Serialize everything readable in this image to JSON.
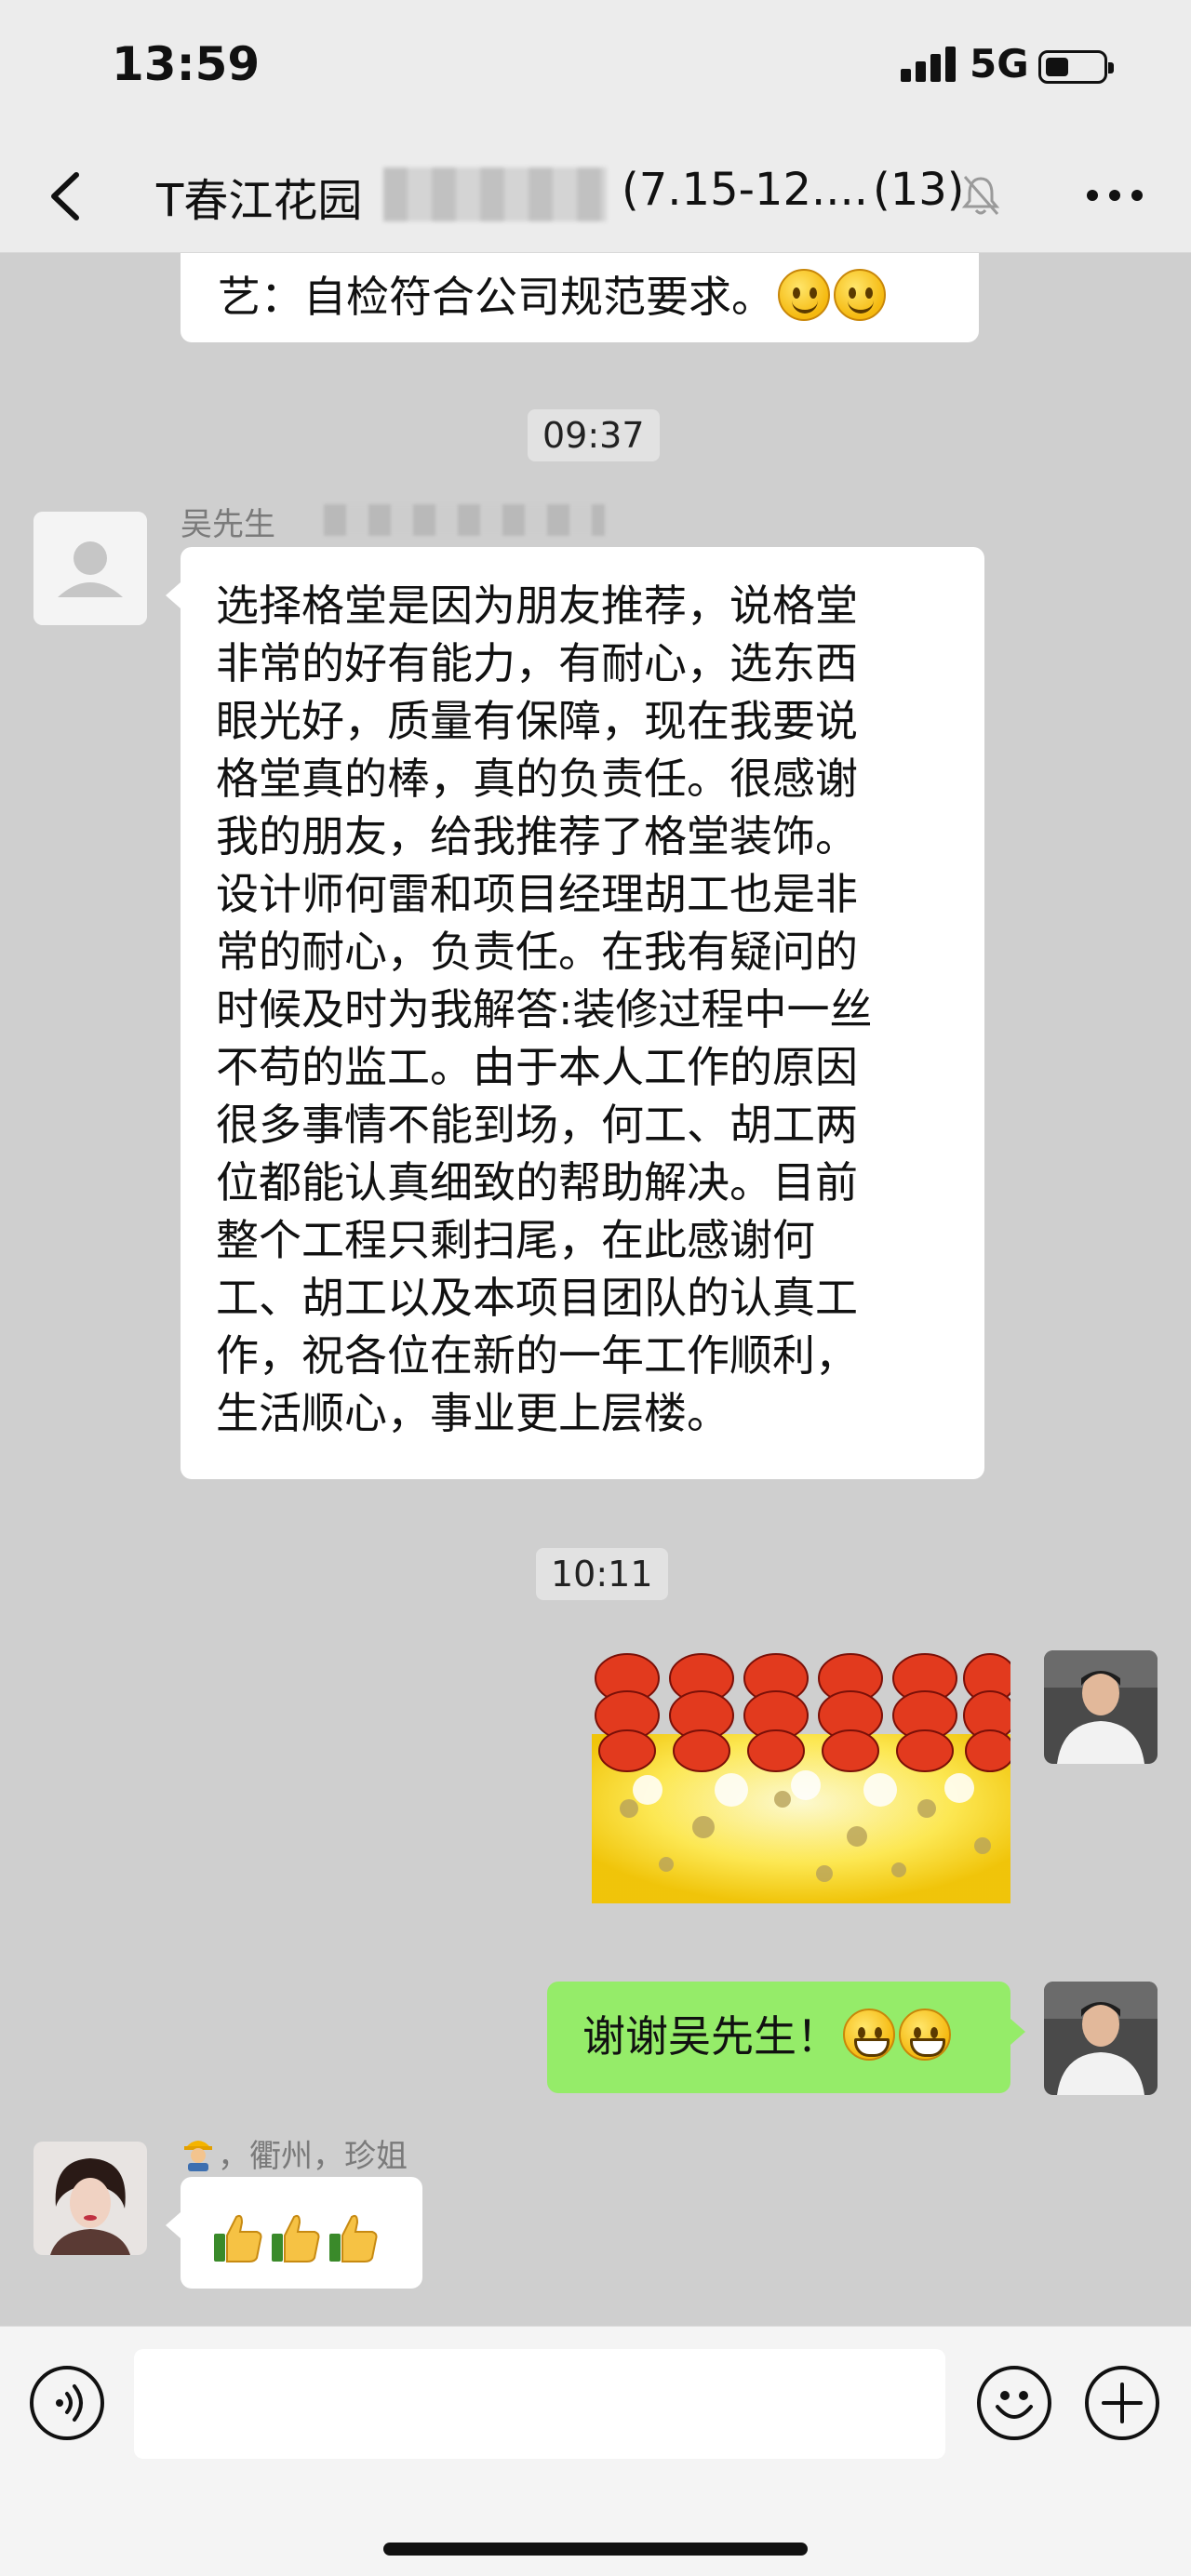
{
  "status_bar": {
    "time": "13:59",
    "network": "5G"
  },
  "nav": {
    "title_prefix": "T春江花园",
    "title_suffix": "(7.15-12....",
    "member_count": "(13)"
  },
  "messages": {
    "top_partial": "艺：自检符合公司规范要求。",
    "time_1": "09:37",
    "sender_1": "吴先生",
    "long_message_lines": [
      "选择格堂是因为朋友推荐，说格堂",
      "非常的好有能力，有耐心，选东西",
      "眼光好，质量有保障，现在我要说",
      "格堂真的棒，真的负责任。很感谢",
      "我的朋友，给我推荐了格堂装饰。",
      "设计师何雷和项目经理胡工也是非",
      "常的耐心，负责任。在我有疑问的",
      "时候及时为我解答:装修过程中一丝",
      "不苟的监工。由于本人工作的原因",
      "很多事情不能到场，何工、胡工两",
      "位都能认真细致的帮助解决。目前",
      "整个工程只剩扫尾，在此感谢何",
      "工、胡工以及本项目团队的认真工",
      "作，祝各位在新的一年工作顺利，",
      "生活顺心，事业更上层楼。"
    ],
    "time_2": "10:11",
    "reply_text": "谢谢吴先生！",
    "sender_2": "，衢州，珍姐"
  },
  "icons": {
    "back": "chevron-left-icon",
    "mute": "bell-slash-icon",
    "more": "more-dots-icon",
    "voice": "voice-icon",
    "emoji": "emoji-icon",
    "add": "plus-icon"
  },
  "colors": {
    "outgoing_bubble": "#95ec69",
    "incoming_bubble": "#ffffff",
    "chat_background": "#cfcfcf"
  }
}
